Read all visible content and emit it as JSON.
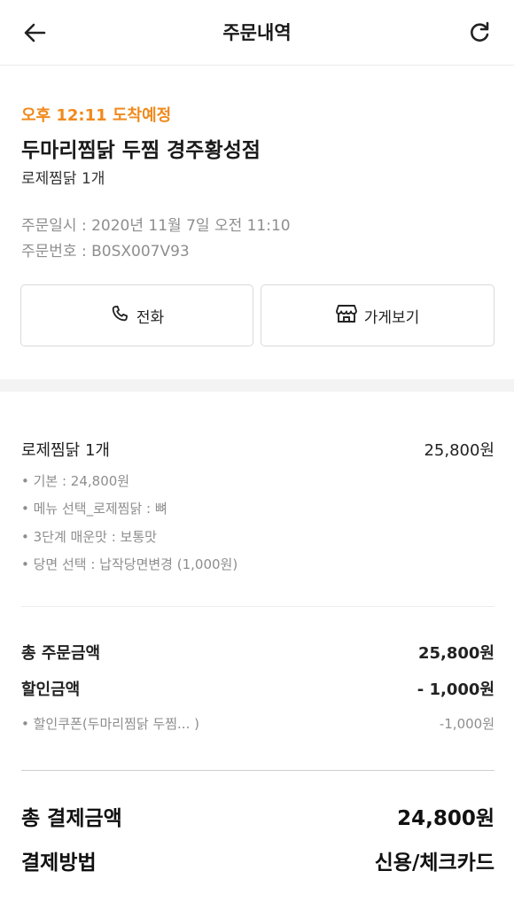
{
  "header": {
    "title": "주문내역",
    "back_icon": "arrow-left-icon",
    "refresh_icon": "refresh-icon"
  },
  "store": {
    "eta": "오후 12:11 도착예정",
    "name": "두마리찜닭 두찜 경주황성점",
    "summary": "로제찜닭 1개",
    "order_date": "주문일시 : 2020년 11월 7일 오전 11:10",
    "order_number": "주문번호 : B0SX007V93",
    "call_label": "전화",
    "store_label": "가게보기",
    "eta_color": "#f08a1c"
  },
  "order": {
    "item_name": "로제찜닭 1개",
    "item_price": "25,800원",
    "options": [
      "• 기본 : 24,800원",
      "• 메뉴 선택_로제찜닭 : 뼈",
      "• 3단계 매운맛 : 보통맛",
      "• 당면 선택 : 납작당면변경 (1,000원)"
    ],
    "total_label": "총 주문금액",
    "total_value": "25,800원",
    "discount_label": "할인금액",
    "discount_value": "- 1,000원",
    "coupon_label": "• 할인쿠폰(두마리찜닭 두찜... )",
    "coupon_value": "-1,000원",
    "pay_label": "총 결제금액",
    "pay_value": "24,800원",
    "method_label": "결제방법",
    "method_value": "신용/체크카드"
  }
}
